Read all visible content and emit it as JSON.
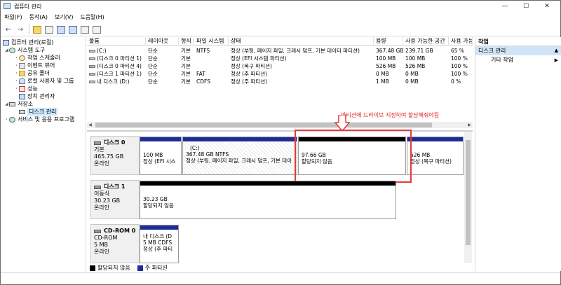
{
  "window": {
    "title": "컴퓨터 관리",
    "min": "—",
    "max": "☐",
    "close": "✕"
  },
  "menu": [
    "파일(F)",
    "동작(A)",
    "보기(V)",
    "도움말(H)"
  ],
  "toolbar": {
    "back": "←",
    "forward": "→"
  },
  "tree": {
    "root": "컴퓨터 관리(로컬)",
    "system_tools": "시스템 도구",
    "task_scheduler": "작업 스케줄러",
    "event_viewer": "이벤트 뷰어",
    "shared_folders": "공유 폴더",
    "local_users": "로컬 사용자 및 그룹",
    "performance": "성능",
    "device_manager": "장치 관리자",
    "storage": "저장소",
    "disk_management": "디스크 관리",
    "services": "서비스 및 응용 프로그램"
  },
  "volume_table": {
    "headers": [
      "볼륨",
      "레이아웃",
      "형식",
      "파일 시스템",
      "상태",
      "용량",
      "사용 가능한 공간",
      "사용 가능"
    ],
    "rows": [
      [
        "(C:)",
        "단순",
        "기본",
        "NTFS",
        "정상 (부팅, 페이지 파일, 크래시 덤프, 기본 데이터 파티션)",
        "367.48 GB",
        "239.71 GB",
        "65 %"
      ],
      [
        "(디스크 0 파티션 1)",
        "단순",
        "기본",
        "",
        "정상 (EFI 시스템 파티션)",
        "100 MB",
        "100 MB",
        "100 %"
      ],
      [
        "(디스크 0 파티션 4)",
        "단순",
        "기본",
        "",
        "정상 (복구 파티션)",
        "526 MB",
        "526 MB",
        "100 %"
      ],
      [
        "(디스크 1 파티션 1)",
        "단순",
        "기본",
        "FAT",
        "정상 (주 파티션)",
        "0 MB",
        "0 MB",
        "100 %"
      ],
      [
        "내 디스크 (D:)",
        "단순",
        "기본",
        "CDFS",
        "정상 (주 파티션)",
        "1 MB",
        "0 MB",
        "0 %"
      ]
    ]
  },
  "annotation": "파티션에 드라이브 지정하여 할당해줘야됨",
  "disks": {
    "disk0": {
      "name": "디스크 0",
      "type": "기본",
      "size": "465.75 GB",
      "status": "온라인",
      "p1": {
        "line1": "100 MB",
        "line2": "정상 (EFI 시스"
      },
      "p2": {
        "line0": "(C:)",
        "line1": "367.48 GB NTFS",
        "line2": "정상 (부팅, 페이지 파일, 크래시 덤프, 기본 데이"
      },
      "p3": {
        "line1": "97.66 GB",
        "line2": "할당되지 않음"
      },
      "p4": {
        "line1": "526 MB",
        "line2": "정상 (복구 파티션)"
      }
    },
    "disk1": {
      "name": "디스크 1",
      "type": "이동식",
      "size": "30.23 GB",
      "status": "온라인",
      "p1": {
        "line1": "30.23 GB",
        "line2": "할당되지 않음"
      }
    },
    "cdrom0": {
      "name": "CD-ROM 0",
      "type": "CD-ROM",
      "size": "5 MB",
      "status": "온라인",
      "p1": {
        "line0": "내 디스크  (D",
        "line1": "5 MB CDFS",
        "line2": "정상 (주 파티"
      }
    }
  },
  "legend": {
    "unallocated": "할당되지 않음",
    "primary": "주 파티션"
  },
  "actions": {
    "header": "작업",
    "section": "디스크 관리",
    "more": "기타 작업"
  },
  "colors": {
    "primary_partition": "#1f2c96",
    "unallocated": "#000000",
    "annotation": "#e0201e",
    "selection": "#cce8ff"
  }
}
